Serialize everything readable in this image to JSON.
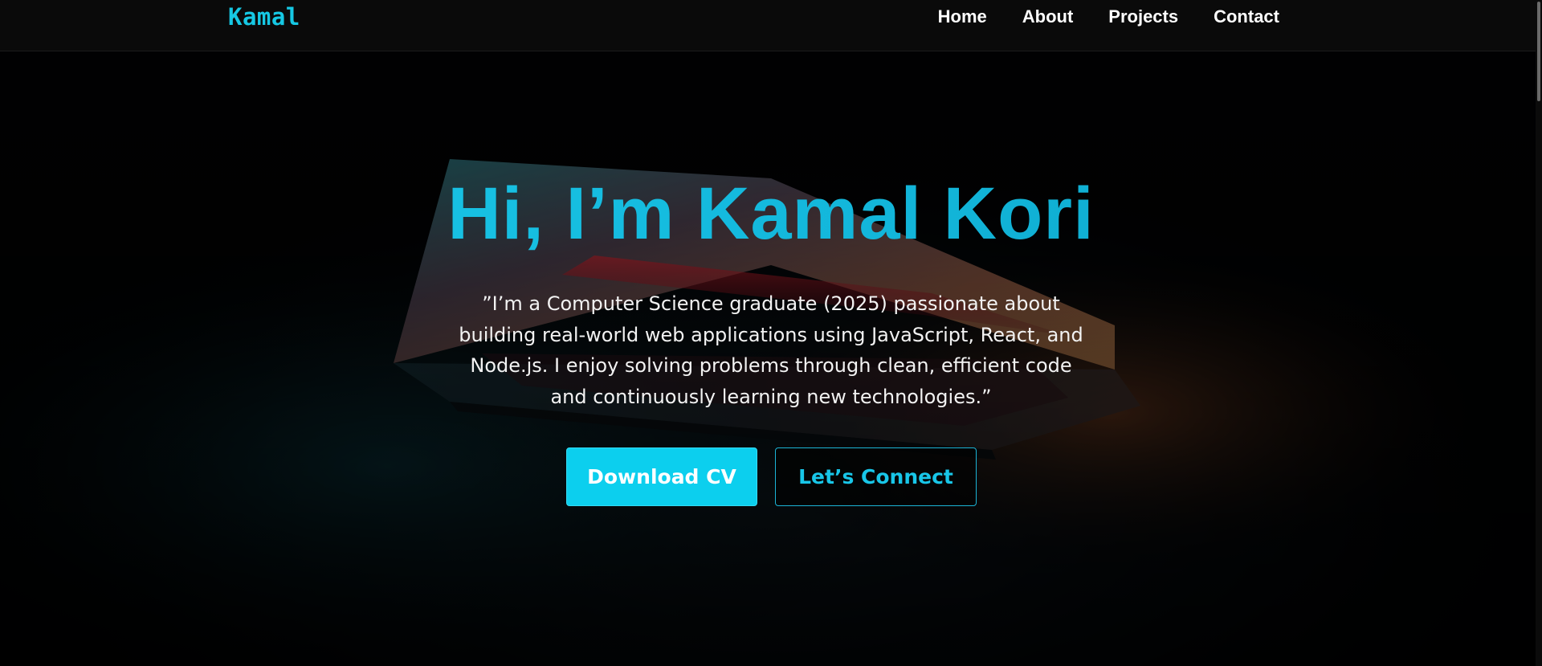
{
  "nav": {
    "brand": "Kamal",
    "links": [
      "Home",
      "About",
      "Projects",
      "Contact"
    ]
  },
  "hero": {
    "title": "Hi, I’m Kamal Kori",
    "bio": "”I’m a Computer Science graduate (2025) passionate about building real-world web applications using JavaScript, React, and Node.js. I enjoy solving problems through clean, efficient code and continuously learning new technologies.”",
    "primary_button": "Download CV",
    "secondary_button": "Let’s Connect"
  },
  "colors": {
    "accent": "#16c8e4",
    "button_primary": "#0ccfee",
    "nav_background": "#0a0a0a",
    "page_background": "#020304",
    "text": "#ffffff"
  }
}
